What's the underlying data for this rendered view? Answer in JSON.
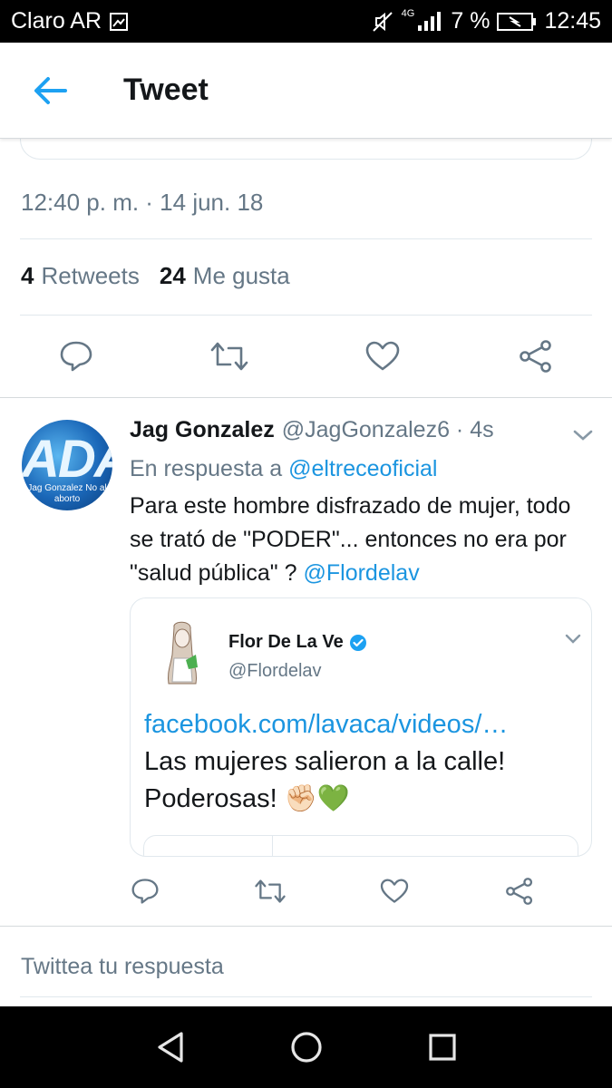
{
  "status_bar": {
    "carrier": "Claro AR",
    "network": "4G",
    "battery": "7 %",
    "time": "12:45"
  },
  "header": {
    "title": "Tweet"
  },
  "main_tweet": {
    "timestamp": "12:40 p. m. · 14 jun. 18",
    "retweets_count": "4",
    "retweets_label": "Retweets",
    "likes_count": "24",
    "likes_label": "Me gusta"
  },
  "reply": {
    "name": "Jag Gonzalez",
    "handle": "@JagGonzalez6 · 4s",
    "avatar_letters": "ADA",
    "avatar_caption": "Jag Gonzalez No al aborto",
    "in_reply_prefix": "En respuesta a",
    "in_reply_handle": "@eltreceoficial",
    "text": "Para este hombre disfrazado de mujer, todo se trató de \"PODER\"... entonces no era por \"salud pública\" ?",
    "mention": "@Flordelav",
    "quote": {
      "name": "Flor De La Ve",
      "handle": "@Flordelav",
      "link": "facebook.com/lavaca/videos/…",
      "text": "Las mujeres salieron a la calle! Poderosas! ✊🏻💚"
    }
  },
  "compose": {
    "placeholder": "Twittea tu respuesta"
  },
  "icons": {
    "reply": "reply-icon",
    "retweet": "retweet-icon",
    "like": "heart-icon",
    "share": "share-icon"
  },
  "colors": {
    "link": "#1b95e0",
    "muted": "#657786",
    "border": "#e1e8ed",
    "verified": "#1da1f2"
  }
}
